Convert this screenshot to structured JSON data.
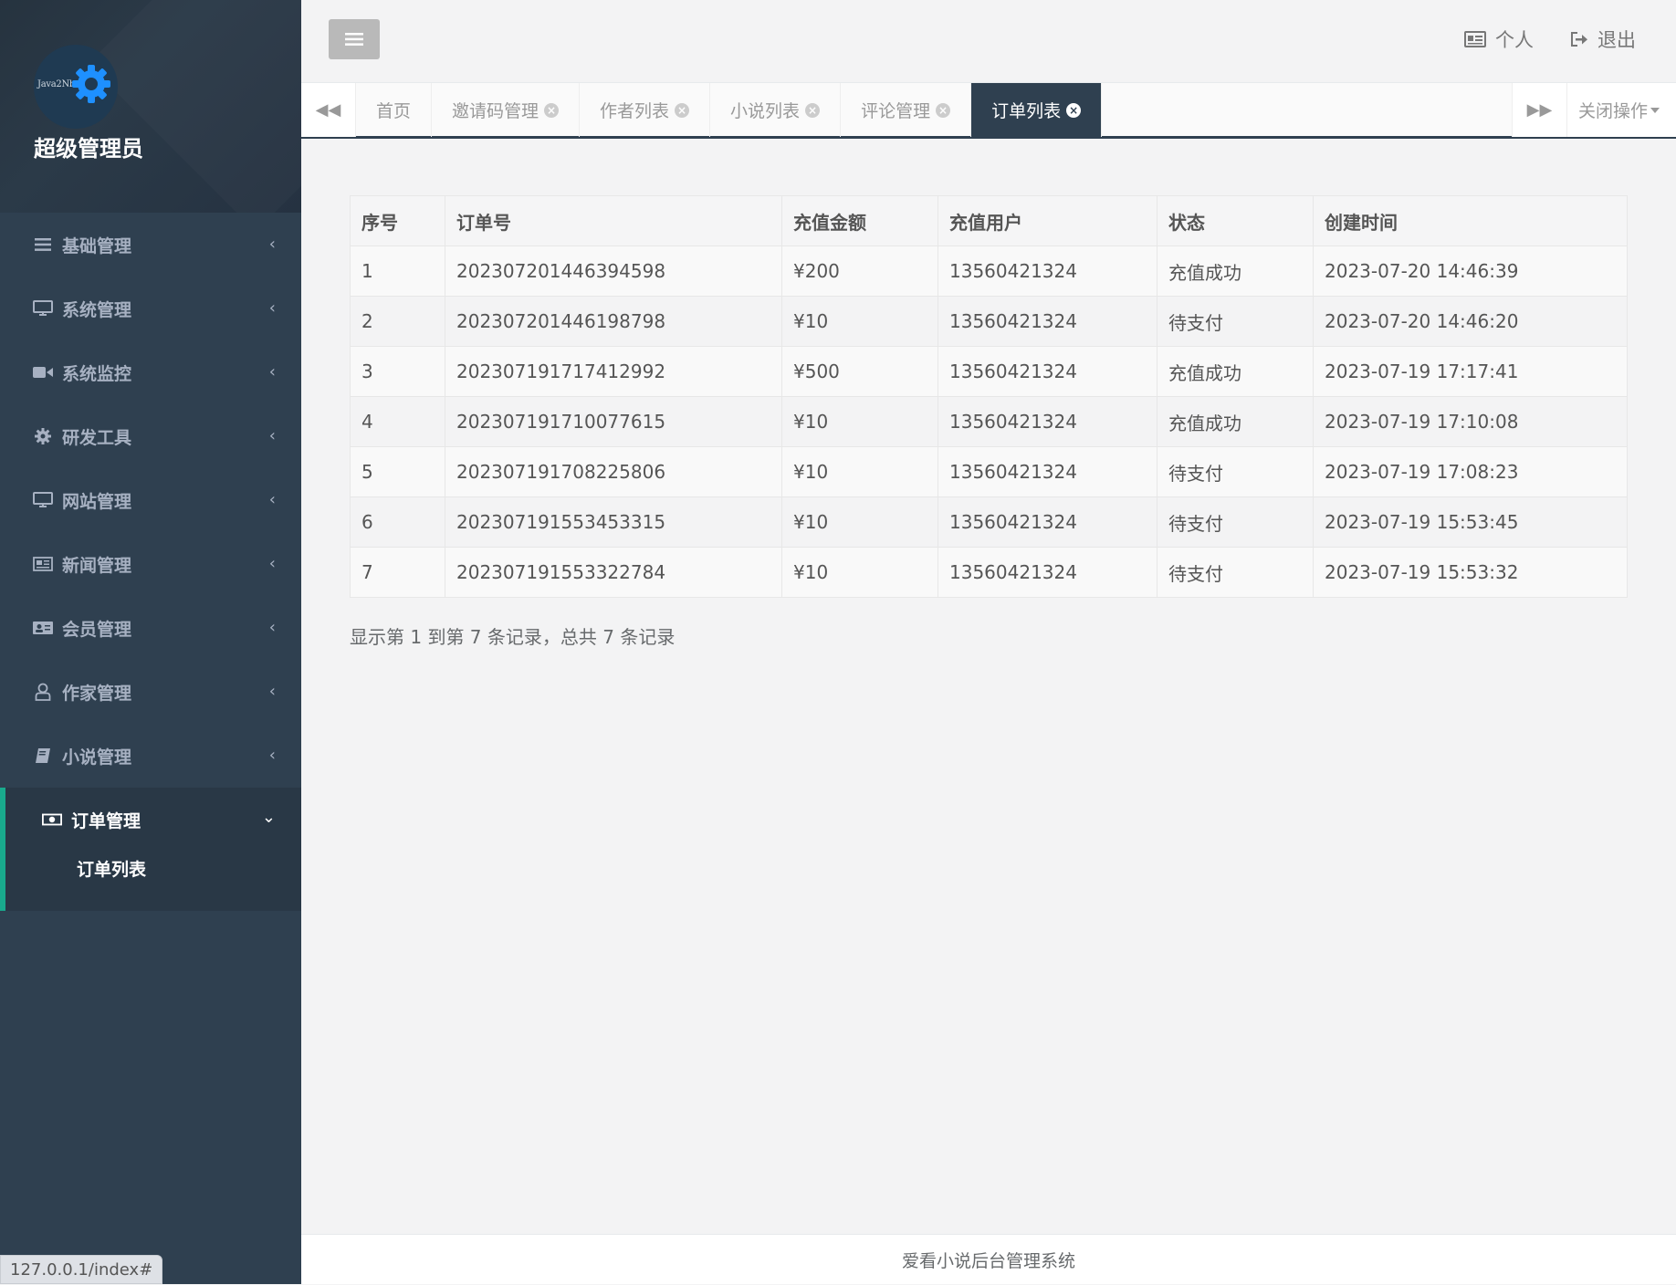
{
  "profile": {
    "avatar_text": "Java2Nb",
    "name": "超级管理员"
  },
  "sidebar": {
    "items": [
      {
        "label": "基础管理",
        "icon": "list-icon"
      },
      {
        "label": "系统管理",
        "icon": "monitor-icon"
      },
      {
        "label": "系统监控",
        "icon": "video-camera-icon"
      },
      {
        "label": "研发工具",
        "icon": "gear-icon"
      },
      {
        "label": "网站管理",
        "icon": "monitor-icon"
      },
      {
        "label": "新闻管理",
        "icon": "newspaper-icon"
      },
      {
        "label": "会员管理",
        "icon": "id-card-icon"
      },
      {
        "label": "作家管理",
        "icon": "user-icon"
      },
      {
        "label": "小说管理",
        "icon": "book-icon"
      },
      {
        "label": "订单管理",
        "icon": "money-icon"
      }
    ],
    "active_sub": "订单列表"
  },
  "topbar": {
    "personal": "个人",
    "logout": "退出"
  },
  "tabs": {
    "items": [
      "首页",
      "邀请码管理",
      "作者列表",
      "小说列表",
      "评论管理",
      "订单列表"
    ],
    "close_ops": "关闭操作"
  },
  "table": {
    "headers": [
      "序号",
      "订单号",
      "充值金额",
      "充值用户",
      "状态",
      "创建时间"
    ],
    "rows": [
      [
        "1",
        "202307201446394598",
        "¥200",
        "13560421324",
        "充值成功",
        "2023-07-20 14:46:39"
      ],
      [
        "2",
        "202307201446198798",
        "¥10",
        "13560421324",
        "待支付",
        "2023-07-20 14:46:20"
      ],
      [
        "3",
        "202307191717412992",
        "¥500",
        "13560421324",
        "充值成功",
        "2023-07-19 17:17:41"
      ],
      [
        "4",
        "202307191710077615",
        "¥10",
        "13560421324",
        "充值成功",
        "2023-07-19 17:10:08"
      ],
      [
        "5",
        "202307191708225806",
        "¥10",
        "13560421324",
        "待支付",
        "2023-07-19 17:08:23"
      ],
      [
        "6",
        "202307191553453315",
        "¥10",
        "13560421324",
        "待支付",
        "2023-07-19 15:53:45"
      ],
      [
        "7",
        "202307191553322784",
        "¥10",
        "13560421324",
        "待支付",
        "2023-07-19 15:53:32"
      ]
    ]
  },
  "pagination": "显示第 1 到第 7 条记录，总共 7 条记录",
  "footer": "爱看小说后台管理系统",
  "status_url": "127.0.0.1/index#"
}
